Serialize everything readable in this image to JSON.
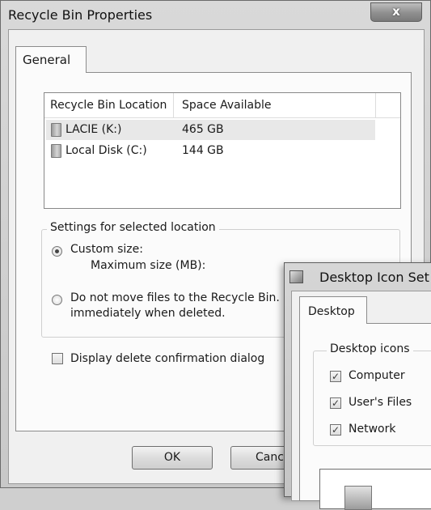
{
  "window": {
    "title": "Recycle Bin Properties",
    "close_label": "x"
  },
  "tabs": {
    "general": "General"
  },
  "list": {
    "columns": [
      "Recycle Bin Location",
      "Space Available"
    ],
    "rows": [
      {
        "name": "LACIE (K:)",
        "space": "465 GB",
        "selected": true
      },
      {
        "name": "Local Disk (C:)",
        "space": "144 GB",
        "selected": false
      }
    ]
  },
  "settings": {
    "legend": "Settings for selected location",
    "custom_size_label": "Custom size:",
    "max_size_label": "Maximum size (MB):",
    "no_move_label_line1": "Do not move files to the Recycle Bin.",
    "no_move_label_line2": "immediately when deleted.",
    "custom_size_checked": true
  },
  "confirm_dialog": {
    "label": "Display delete confirmation dialog",
    "checked": false
  },
  "buttons": {
    "ok": "OK",
    "cancel": "Canc"
  },
  "desktop_icon_settings": {
    "title": "Desktop Icon Set",
    "tab": "Desktop",
    "group_legend": "Desktop icons",
    "items": [
      {
        "label": "Computer",
        "checked": true
      },
      {
        "label": "User's Files",
        "checked": true
      },
      {
        "label": "Network",
        "checked": true
      }
    ],
    "check_glyph": "✓"
  }
}
